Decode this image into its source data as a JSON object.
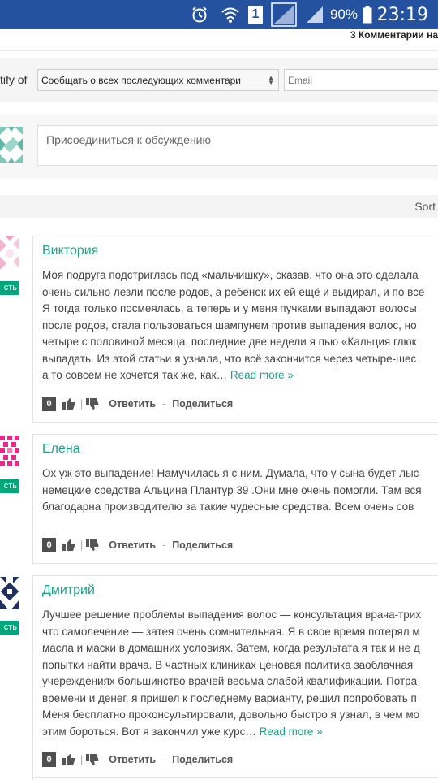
{
  "status_bar": {
    "battery_percent": "90%",
    "time": "23:19",
    "sim_label": "1",
    "icons": [
      "alarm-icon",
      "wifi-icon",
      "sim-icon",
      "signal-off-icon",
      "signal-icon",
      "battery-icon"
    ]
  },
  "header": {
    "comment_count": "3 Комментарии на"
  },
  "notify": {
    "label": "tify of",
    "select_value": "Сообщать о всех последующих комментари",
    "email_placeholder": "Email"
  },
  "join": {
    "placeholder": "Присоединиться к обсуждению"
  },
  "sort": {
    "label": "Sort"
  },
  "reply_tag_label": "сть",
  "comments": [
    {
      "author": "Виктория",
      "lines": [
        "Моя подруга подстриглась под «мальчишку», сказав, что она это сделала",
        "очень сильно лезли после родов, а ребенок их ей ещё и выдирал, и по все",
        "Я тогда только посмеялась, а теперь и у меня пучками выпадают волосы",
        "после родов, стала пользоваться шампунем против выпадения волос, но",
        "четыре с половиной месяца, последние две недели я пью «Кальция глюк",
        "выпадать. Из этой статьи я узнала, что всё закончится через четыре-шес",
        "а то совсем не хочется так же, как…"
      ],
      "read_more": "Read more »",
      "votes": "0",
      "reply": "Ответить",
      "share": "Поделиться"
    },
    {
      "author": "Елена",
      "lines": [
        "Ох уж это выпадение! Намучилась я с ним. Думала, что у сына будет лыс",
        "немецкие средства Альцина Плантур 39 .Они мне очень помогли. Там вся",
        "благодарна производителю за такие чудесные средства. Всем очень сов"
      ],
      "read_more": "",
      "votes": "0",
      "reply": "Ответить",
      "share": "Поделиться"
    },
    {
      "author": "Дмитрий",
      "lines": [
        "Лучшее решение проблемы выпадения волос — консультация врача-трих",
        "что самолечение — затея очень сомнительная. Я в свое время потерял м",
        "масла и маски в домашних условиях. Затем, когда результата я так и не д",
        "попытки найти врача. В частных клиниках ценовая политика заоблачная",
        "учереждениях большинство врачей весьма слабой квалификации. Потра",
        "времени и денег, я пришел к последнему варианту, решил попробовать п",
        "Меня бесплатно проконсультировали, довольно быстро я узнал, в чем мо",
        "этим бороться. Вот я закончил уже курс…"
      ],
      "read_more": "Read more »",
      "votes": "0",
      "reply": "Ответить",
      "share": "Поделиться"
    }
  ]
}
